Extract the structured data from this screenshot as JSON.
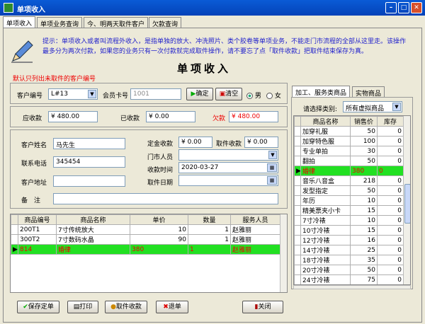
{
  "window": {
    "title": "单项收入",
    "min": "–",
    "max": "□",
    "close": "✕"
  },
  "tabs": [
    "单项收入",
    "单项业务查询",
    "今、明两天取件客户",
    "欠款查询"
  ],
  "hint": {
    "line1": "提示：单项收入或者叫流程外收入，是指单独的放大、冲洗照片、类个胶卷等单项业务，不能走门市流程的全部从这里走。该操作",
    "line2": "最多分为两次付款，如果您的业务只有一次付款就完成取件操作，请不要忘了点「取件收款」把取件结束保存为真。"
  },
  "heading": "单项收入",
  "default_note": "默认只列出未取件的客户编号",
  "customer": {
    "id_label": "客户编号",
    "id_value": "L#13",
    "card_label": "会员卡号",
    "card_value": "1001",
    "confirm": "确定",
    "clear": "清空",
    "male": "男",
    "female": "女"
  },
  "amounts": {
    "due_label": "应收款",
    "due_value": "¥ 480.00",
    "paid_label": "已收款",
    "paid_value": "¥ 0.00",
    "owe_label": "欠款",
    "owe_value": "¥ 480.00"
  },
  "info": {
    "name_label": "客户姓名",
    "name_value": "马先生",
    "phone_label": "联系电话",
    "phone_value": "345454",
    "addr_label": "客户地址",
    "addr_value": "",
    "note_label": "备　注",
    "note_value": "",
    "deposit_label": "定金收款",
    "deposit_value": "¥ 0.00",
    "pickup_pay_label": "取件收款",
    "pickup_pay_value": "¥ 0.00",
    "staff_label": "门市人员",
    "staff_value": "",
    "time_label": "收款时间",
    "time_value": "2020-03-27",
    "pickup_date_label": "取件日期",
    "pickup_date_value": ""
  },
  "order_table": {
    "headers": [
      "商品编号",
      "商品名称",
      "单价",
      "数量",
      "服务人员"
    ],
    "rows": [
      {
        "id": "200T1",
        "name": "7寸传统放大",
        "price": "10",
        "qty": "1",
        "staff": "赵雅丽"
      },
      {
        "id": "300T2",
        "name": "7寸数码水晶",
        "price": "90",
        "qty": "1",
        "staff": "赵雅丽"
      },
      {
        "id": "814",
        "name": "婚律",
        "price": "380",
        "qty": "1",
        "staff": "赵雅丽"
      }
    ]
  },
  "buttons": {
    "save": "保存定单",
    "print": "打印",
    "pickup": "取件收款",
    "refund": "退单",
    "close": "关闭"
  },
  "right_panel": {
    "tabs": [
      "加工、服务类商品",
      "实物商品"
    ],
    "category_label": "请选择类别:",
    "category_value": "所有虚拟商品",
    "headers": [
      "商品名称",
      "销售价",
      "库存"
    ],
    "rows": [
      {
        "name": "加穿礼服",
        "price": "50",
        "stock": "0"
      },
      {
        "name": "加穿特色服",
        "price": "100",
        "stock": "0"
      },
      {
        "name": "专业单拍",
        "price": "30",
        "stock": "0"
      },
      {
        "name": "翻拍",
        "price": "50",
        "stock": "0"
      },
      {
        "name": "婚律",
        "price": "380",
        "stock": "0"
      },
      {
        "name": "音乐八音盒",
        "price": "218",
        "stock": "0"
      },
      {
        "name": "发型指定",
        "price": "50",
        "stock": "0"
      },
      {
        "name": "年历",
        "price": "10",
        "stock": "0"
      },
      {
        "name": "精美票夹小卡",
        "price": "15",
        "stock": "0"
      },
      {
        "name": "7寸冷裱",
        "price": "10",
        "stock": "0"
      },
      {
        "name": "10寸冷裱",
        "price": "15",
        "stock": "0"
      },
      {
        "name": "12寸冷裱",
        "price": "16",
        "stock": "0"
      },
      {
        "name": "14寸冷裱",
        "price": "25",
        "stock": "0"
      },
      {
        "name": "18寸冷裱",
        "price": "35",
        "stock": "0"
      },
      {
        "name": "20寸冷裱",
        "price": "50",
        "stock": "0"
      },
      {
        "name": "24寸冷裱",
        "price": "75",
        "stock": "0"
      }
    ]
  }
}
